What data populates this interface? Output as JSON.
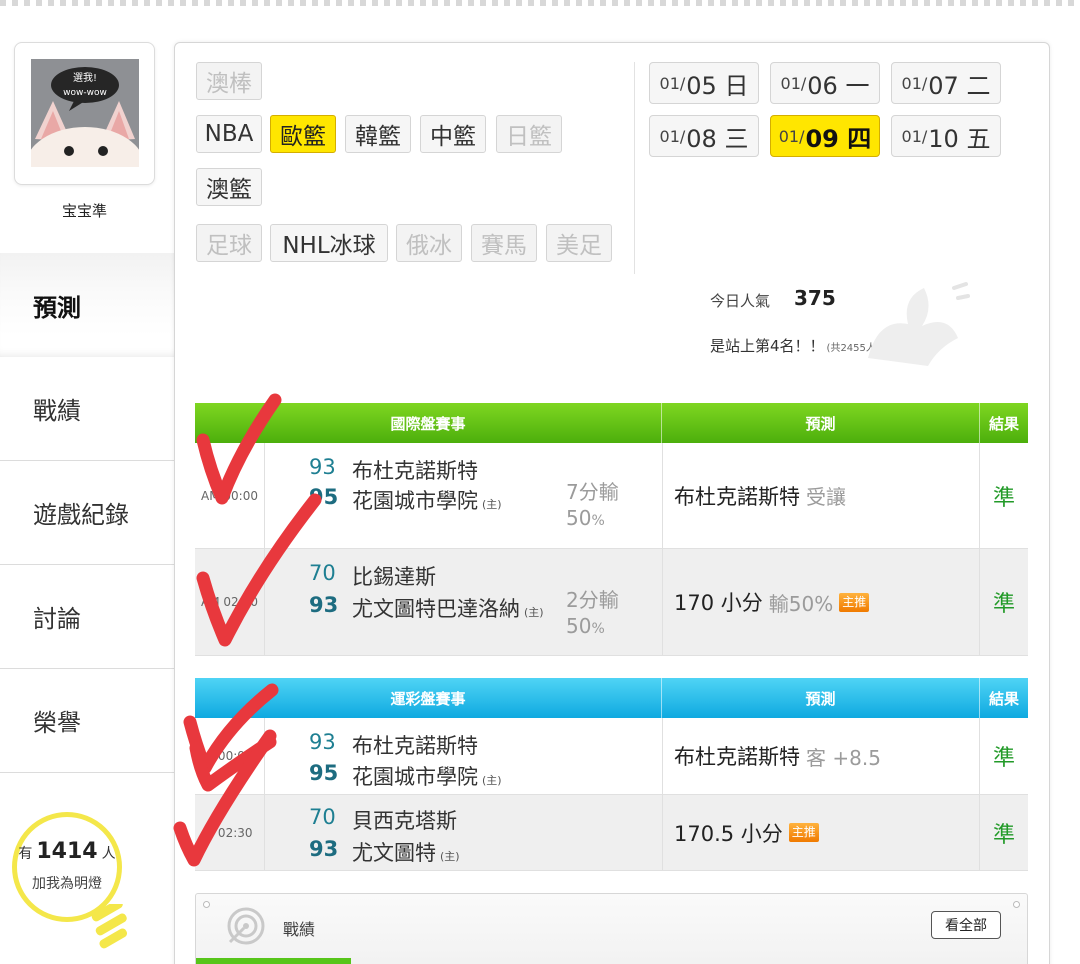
{
  "profile": {
    "name": "宝宝準",
    "avatar_text_line1": "選我!",
    "avatar_text_line2": "wow-wow"
  },
  "nav": [
    "預測",
    "戰績",
    "遊戲紀錄",
    "討論",
    "榮譽"
  ],
  "fans": {
    "prefix": "有",
    "count": "1414",
    "suffix": "人",
    "caption": "加我為明燈"
  },
  "sports": {
    "row1": [
      {
        "label": "澳棒",
        "state": "disabled"
      }
    ],
    "row2": [
      {
        "label": "NBA",
        "state": "normal"
      },
      {
        "label": "歐籃",
        "state": "active"
      },
      {
        "label": "韓籃",
        "state": "normal"
      },
      {
        "label": "中籃",
        "state": "normal"
      },
      {
        "label": "日籃",
        "state": "disabled"
      }
    ],
    "row3": [
      {
        "label": "澳籃",
        "state": "normal"
      }
    ],
    "row4": [
      {
        "label": "足球",
        "state": "disabled"
      },
      {
        "label": "NHL冰球",
        "state": "normal"
      },
      {
        "label": "俄冰",
        "state": "disabled"
      },
      {
        "label": "賽馬",
        "state": "disabled"
      },
      {
        "label": "美足",
        "state": "disabled"
      }
    ]
  },
  "dates": [
    {
      "m": "01/",
      "d": "05 日",
      "active": false
    },
    {
      "m": "01/",
      "d": "06 一",
      "active": false
    },
    {
      "m": "01/",
      "d": "07 二",
      "active": false
    },
    {
      "m": "01/",
      "d": "08 三",
      "active": false
    },
    {
      "m": "01/",
      "d": "09 四",
      "active": true
    },
    {
      "m": "01/",
      "d": "10 五",
      "active": false
    }
  ],
  "popularity": {
    "label": "今日人氣",
    "value": "375",
    "rank_text": "是站上第4名！！",
    "rank_total": "(共2455人)"
  },
  "intl": {
    "headers": [
      "國際盤賽事",
      "預測",
      "結果"
    ],
    "rows": [
      {
        "time": "AM 00:00",
        "s1": "93",
        "t1": "布杜克諾斯特",
        "s2": "95",
        "t2": "花園城市學院",
        "home": "(主)",
        "spread1": "7分輸",
        "spread2": "50",
        "pct": "%",
        "pred": "布杜克諾斯特",
        "pred_sub": "受讓",
        "badge": "",
        "result": "準"
      },
      {
        "time": "AM 02:30",
        "s1": "70",
        "t1": "比錫達斯",
        "s2": "93",
        "t2": "尤文圖特巴達洛納",
        "home": "(主)",
        "spread1": "2分輸",
        "spread2": "50",
        "pct": "%",
        "pred": "170 小分",
        "pred_sub": "輸50%",
        "badge": "主推",
        "result": "準"
      }
    ]
  },
  "lottery": {
    "headers": [
      "運彩盤賽事",
      "預測",
      "結果"
    ],
    "rows": [
      {
        "time": "3 00:00",
        "s1": "93",
        "t1": "布杜克諾斯特",
        "s2": "95",
        "t2": "花園城市學院",
        "home": "(主)",
        "pred": "布杜克諾斯特",
        "pred_sub": "客 +8.5",
        "badge": "",
        "result": "準"
      },
      {
        "time": "1 02:30",
        "s1": "70",
        "t1": "貝西克塔斯",
        "s2": "93",
        "t2": "尤文圖特",
        "home": "(主)",
        "pred": "170.5 小分",
        "pred_sub": "",
        "badge": "主推",
        "result": "準"
      }
    ]
  },
  "record": {
    "title": "戰績",
    "view_all": "看全部"
  },
  "colors": {
    "accent_yellow": "#ffe600",
    "header_green": "#4caf0c",
    "header_blue": "#0fa9e0",
    "check_red": "#e8383d",
    "result_green": "#229a28"
  }
}
